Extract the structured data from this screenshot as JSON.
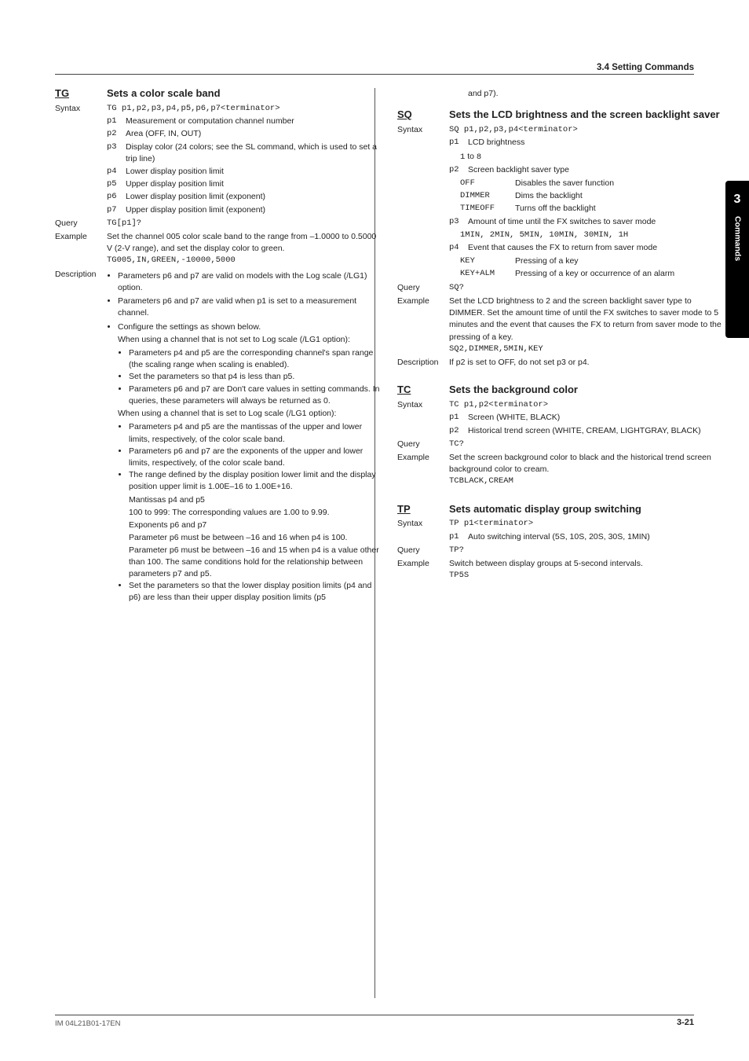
{
  "header_section": "3.4  Setting Commands",
  "side_tab": {
    "num": "3",
    "label": "Commands"
  },
  "footer": {
    "left": "IM 04L21B01-17EN",
    "right": "3-21"
  },
  "tg": {
    "name": "TG",
    "title": "Sets a color scale band",
    "syntax_label": "Syntax",
    "syntax_line": "TG p1,p2,p3,p4,p5,p6,p7<terminator>",
    "params": [
      {
        "k": "p1",
        "t": "Measurement or computation channel number"
      },
      {
        "k": "p2",
        "t": "Area (OFF, IN, OUT)"
      },
      {
        "k": "p3",
        "t": "Display color (24 colors; see the SL command, which is used to set a trip line)"
      },
      {
        "k": "p4",
        "t": "Lower display position limit"
      },
      {
        "k": "p5",
        "t": "Upper display position limit"
      },
      {
        "k": "p6",
        "t": "Lower display position limit (exponent)"
      },
      {
        "k": "p7",
        "t": "Upper display position limit (exponent)"
      }
    ],
    "query_label": "Query",
    "query_val": "TG[p1]?",
    "example_label": "Example",
    "example_text": "Set the channel 005 color scale band to the range from –1.0000 to 0.5000 V (2-V range), and set the display color to green.",
    "example_code": "TG005,IN,GREEN,-10000,5000",
    "desc_label": "Description",
    "desc_bullets_top": [
      "Parameters p6 and p7 are valid on models with the Log scale (/LG1) option.",
      "Parameters p6 and p7 are valid when p1 is set to a measurement channel.",
      "Configure the settings as shown below."
    ],
    "not_log_intro": "When using a channel that is not set to Log scale (/LG1 option):",
    "not_log_bullets": [
      "Parameters p4 and p5 are the corresponding channel's span range (the scaling range when scaling is enabled).",
      "Set the parameters so that p4 is less than p5.",
      "Parameters p6 and p7 are Don't care values in setting commands. In queries, these parameters will always be returned as 0."
    ],
    "log_intro": "When using a channel that is set to Log scale (/LG1 option):",
    "log_bullets": [
      "Parameters p4 and p5 are the mantissas of the upper and lower limits, respectively, of the color scale band.",
      "Parameters p6 and p7 are the exponents of the upper and lower limits, respectively, of the color scale band."
    ],
    "range_bullet": "The range defined by the display position lower limit and the display position upper limit is 1.00E–16 to 1.00E+16.",
    "mantissa_h": "Mantissas p4 and p5",
    "mantissa_t": "100 to 999: The corresponding values are 1.00 to 9.99.",
    "exp_h": "Exponents p6 and p7",
    "exp_t": "Parameter p6 must be between –16 and 16 when p4 is 100. Parameter p6 must be between –16 and 15 when p4 is a value other than 100. The same conditions hold for the relationship between parameters p7 and p5.",
    "last_bullet": "Set the parameters so that the lower display position limits (p4 and p6) are less than their upper display position limits (p5"
  },
  "right_top_continuation": "and p7).",
  "sq": {
    "name": "SQ",
    "title": "Sets the LCD brightness and the screen backlight saver",
    "syntax_label": "Syntax",
    "syntax_line": "SQ p1,p2,p3,p4<terminator>",
    "p1_k": "p1",
    "p1_t": "LCD brightness",
    "p1_sub": "1 to 8",
    "p2_k": "p2",
    "p2_t": "Screen backlight saver type",
    "p2_rows": [
      {
        "k": "OFF",
        "v": "Disables the saver function"
      },
      {
        "k": "DIMMER",
        "v": "Dims the backlight"
      },
      {
        "k": "TIMEOFF",
        "v": "Turns off the backlight"
      }
    ],
    "p3_k": "p3",
    "p3_t": "Amount of time until the FX switches to saver mode",
    "p3_sub": "1MIN, 2MIN, 5MIN, 10MIN, 30MIN, 1H",
    "p4_k": "p4",
    "p4_t": "Event that causes the FX to return from saver mode",
    "p4_rows": [
      {
        "k": "KEY",
        "v": "Pressing of a key"
      },
      {
        "k": "KEY+ALM",
        "v": "Pressing of a key or occurrence of an alarm"
      }
    ],
    "query_label": "Query",
    "query_val": "SQ?",
    "example_label": "Example",
    "example_text": "Set the LCD brightness to 2 and the screen backlight saver type to DIMMER. Set the amount time of until the FX switches to saver mode to 5 minutes and the event that causes the FX to return from saver mode to the pressing of a key.",
    "example_code": "SQ2,DIMMER,5MIN,KEY",
    "desc_label": "Description",
    "desc_text": "If p2 is set to OFF, do not set p3 or p4."
  },
  "tc": {
    "name": "TC",
    "title": "Sets the background color",
    "syntax_label": "Syntax",
    "syntax_line": "TC p1,p2<terminator>",
    "params": [
      {
        "k": "p1",
        "t": "Screen (WHITE, BLACK)"
      },
      {
        "k": "p2",
        "t": "Historical trend screen (WHITE, CREAM, LIGHTGRAY, BLACK)"
      }
    ],
    "query_label": "Query",
    "query_val": "TC?",
    "example_label": "Example",
    "example_text": "Set the screen background color to black and the historical trend screen background color to cream.",
    "example_code": "TCBLACK,CREAM"
  },
  "tp": {
    "name": "TP",
    "title": "Sets automatic display group switching",
    "syntax_label": "Syntax",
    "syntax_line": "TP p1<terminator>",
    "params": [
      {
        "k": "p1",
        "t": "Auto switching interval (5S, 10S, 20S, 30S, 1MIN)"
      }
    ],
    "query_label": "Query",
    "query_val": "TP?",
    "example_label": "Example",
    "example_text": "Switch between display groups at 5-second intervals.",
    "example_code": "TP5S"
  }
}
